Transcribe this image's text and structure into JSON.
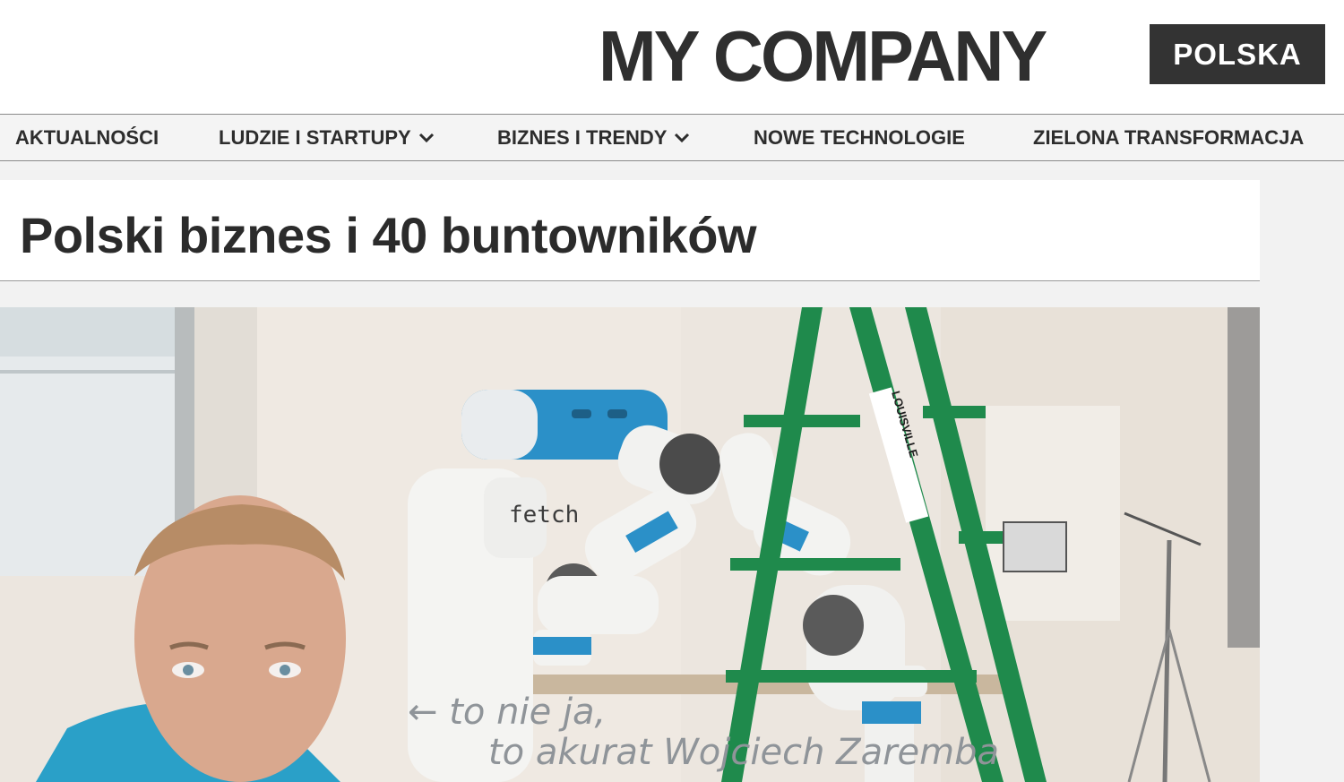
{
  "header": {
    "logo_main": "MY COMPANY",
    "logo_badge": "POLSKA"
  },
  "nav": {
    "items": [
      {
        "label": "AKTUALNOŚCI",
        "has_dropdown": false
      },
      {
        "label": "LUDZIE I STARTUPY",
        "has_dropdown": true
      },
      {
        "label": "BIZNES I TRENDY",
        "has_dropdown": true
      },
      {
        "label": "NOWE TECHNOLOGIE",
        "has_dropdown": false
      },
      {
        "label": "ZIELONA TRANSFORMACJA",
        "has_dropdown": false
      }
    ]
  },
  "article": {
    "title": "Polski biznes i 40 buntowników"
  },
  "hero_image": {
    "robot_label": "fetch",
    "ladder_label": "LOUISVILLE",
    "handwritten_note_line1": "← to nie ja,",
    "handwritten_note_line2": "to akurat Wojciech Zaremba"
  },
  "colors": {
    "accent_dark": "#333333",
    "header_bg": "#ffffff",
    "nav_bg": "#f4f4f4",
    "ladder_green": "#1f8a4c",
    "robot_blue": "#2b90c8"
  }
}
